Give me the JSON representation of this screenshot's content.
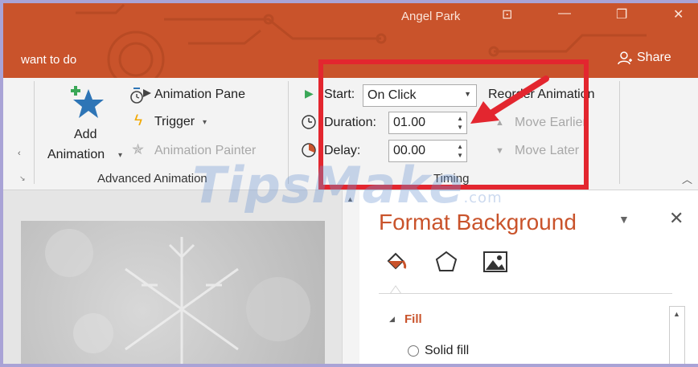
{
  "titlebar": {
    "user_name": "Angel Park",
    "tell_me": "want to do",
    "share_label": "Share",
    "accent": "#c9532b"
  },
  "ribbon": {
    "advanced_animation": {
      "add_animation_label_1": "Add",
      "add_animation_label_2": "Animation",
      "animation_pane": "Animation Pane",
      "trigger": "Trigger",
      "animation_painter": "Animation Painter",
      "group_label": "Advanced Animation"
    },
    "timing": {
      "start_label": "Start:",
      "start_value": "On Click",
      "duration_label": "Duration:",
      "duration_value": "01.00",
      "delay_label": "Delay:",
      "delay_value": "00.00",
      "group_label": "Timing"
    },
    "reorder": {
      "reorder_label": "Reorder Animation",
      "move_earlier": "Move Earlier",
      "move_later": "Move Later"
    }
  },
  "format_pane": {
    "title": "Format Background",
    "section_fill": "Fill",
    "solid_fill": "Solid fill"
  },
  "watermark": {
    "brand": "TipsMake",
    "suffix": ".com"
  },
  "icons": [
    "add-animation-star-icon",
    "animation-pane-icon",
    "trigger-lightning-icon",
    "animation-painter-icon",
    "start-play-icon",
    "duration-clock-icon",
    "delay-clock-icon",
    "move-earlier-icon",
    "move-later-icon",
    "share-person-icon",
    "fill-bucket-icon",
    "effects-pentagon-icon",
    "picture-icon"
  ]
}
